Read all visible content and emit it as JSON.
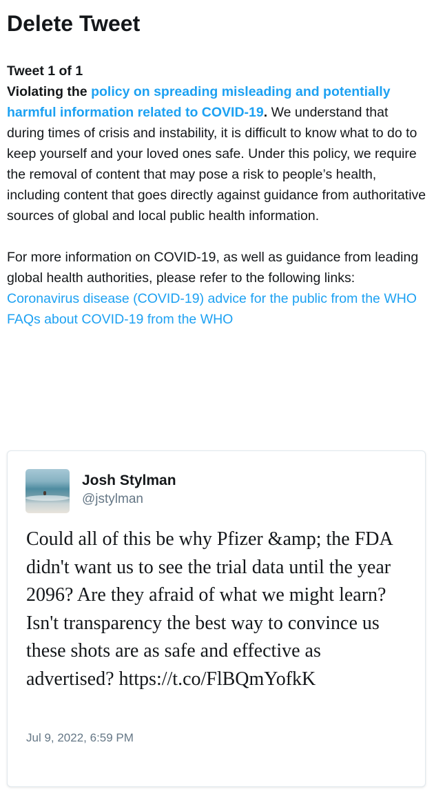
{
  "header": {
    "title": "Delete Tweet"
  },
  "notice": {
    "tweet_count": "Tweet 1 of 1",
    "violating_prefix": "Violating the ",
    "policy_link": "policy on spreading misleading and potentially harmful information related to COVID-19",
    "violating_suffix": ".",
    "paragraph1": "We understand that during times of crisis and instability, it is difficult to know what to do to keep yourself and your loved ones safe. Under this policy, we require the removal of content that may pose a risk to people’s health, including content that goes directly against guidance from authoritative sources of global and local public health information.",
    "paragraph2": "For more information on COVID-19, as well as guidance from leading global health authorities, please refer to the following links:",
    "links": [
      "Coronavirus disease (COVID-19) advice for the public from the WHO",
      "FAQs about COVID-19 from the WHO"
    ]
  },
  "tweet": {
    "author_name": "Josh Stylman",
    "author_handle": "@jstylman",
    "text": "Could all of this be why Pfizer &amp; the FDA didn't want us to see the trial data until the year 2096? Are they afraid of what we might learn? Isn't transparency the best way to convince us these shots are as safe and effective as advertised? https://t.co/FlBQmYofkK",
    "date": "Jul 9, 2022, 6:59 PM"
  },
  "colors": {
    "link": "#1da1f2",
    "text": "#14171a",
    "secondary": "#657786",
    "card_border": "#e1e8ed"
  },
  "icons": {
    "avatar": "beach-photo-avatar"
  }
}
